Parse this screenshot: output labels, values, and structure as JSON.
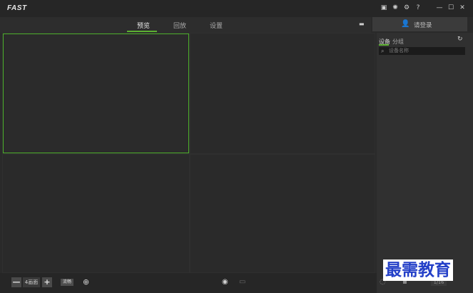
{
  "app": {
    "logo": "FAST"
  },
  "titlebar": {
    "icons": [
      "save-icon",
      "brightness-icon",
      "settings-icon",
      "help-icon",
      "minimize-icon",
      "maximize-icon",
      "close-icon"
    ],
    "glyphs": [
      "▣",
      "✺",
      "⚙",
      "?",
      "—",
      "☐",
      "✕"
    ]
  },
  "tabs": [
    {
      "label": "预览",
      "active": true
    },
    {
      "label": "回放",
      "active": false
    },
    {
      "label": "设置",
      "active": false
    }
  ],
  "login": {
    "label": "请登录"
  },
  "sidepanel": {
    "tabs": [
      {
        "label": "设备",
        "active": true
      },
      {
        "label": "分组",
        "active": false
      }
    ],
    "search_placeholder": "设备名称"
  },
  "bottombar": {
    "minus": "—",
    "screen_count": "4画面",
    "plus": "+",
    "stream_label": "流畅"
  },
  "sidebottom": {
    "page": "1/16"
  },
  "watermark": "最需教育",
  "colors": {
    "accent": "#5db132",
    "background": "#2a2a2a"
  }
}
